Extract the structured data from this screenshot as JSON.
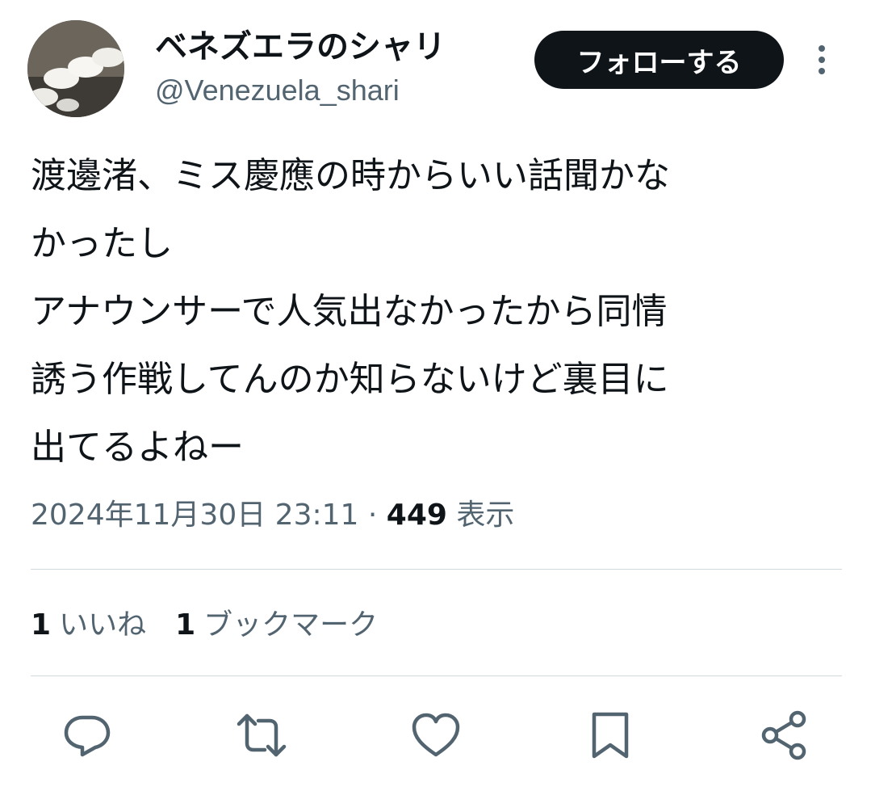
{
  "author": {
    "display_name": "ベネズエラのシャリ",
    "handle": "@Venezuela_shari"
  },
  "follow_button_label": "フォローする",
  "tweet": {
    "lines": [
      "渡邊渚、ミス慶應の時からいい話聞かな",
      "かったし",
      "アナウンサーで人気出なかったから同情",
      "誘う作戦してんのか知らないけど裏目に",
      "出てるよねー"
    ]
  },
  "meta": {
    "timestamp": "2024年11月30日 23:11",
    "separator": " · ",
    "views_count": "449",
    "views_label": " 表示"
  },
  "stats": {
    "likes_count": "1",
    "likes_label": "いいね",
    "bookmarks_count": "1",
    "bookmarks_label": "ブックマーク"
  },
  "actions": [
    "reply-icon",
    "retweet-icon",
    "like-icon",
    "bookmark-icon",
    "share-icon"
  ],
  "colors": {
    "text_primary": "#0f1419",
    "text_secondary": "#536471",
    "divider": "#cfd9de",
    "follow_button_bg": "#0f1419"
  }
}
